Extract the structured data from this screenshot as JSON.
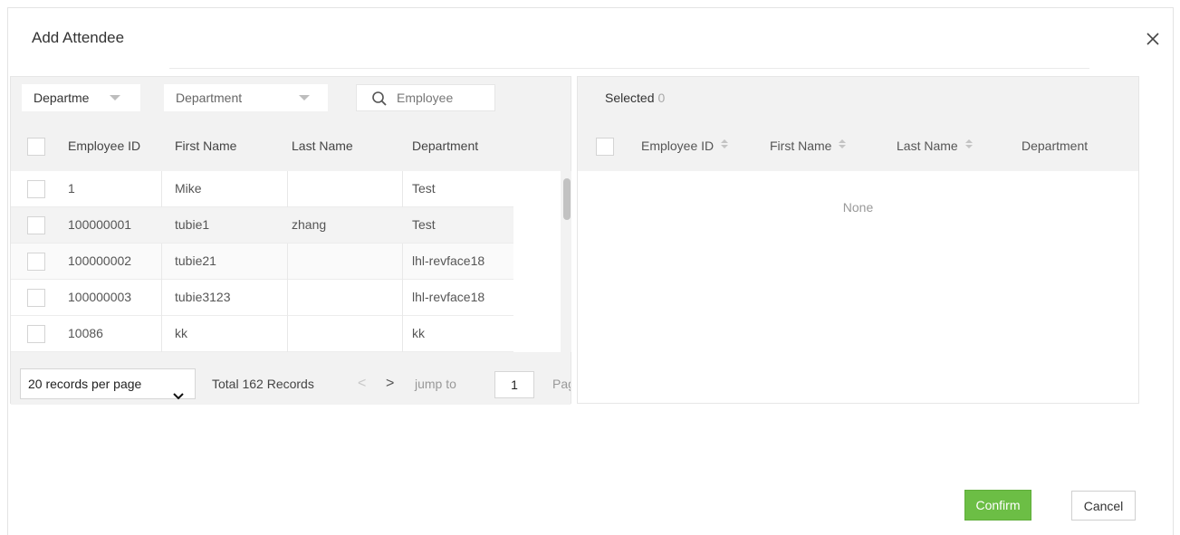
{
  "dialog": {
    "title": "Add Attendee"
  },
  "filters": {
    "field_select": "Departme",
    "department_select": "Department",
    "search_placeholder": "Employee"
  },
  "left_table": {
    "headers": {
      "employee_id": "Employee ID",
      "first_name": "First Name",
      "last_name": "Last Name",
      "department": "Department"
    },
    "rows": [
      {
        "employee_id": "1",
        "first_name": "Mike",
        "last_name": "",
        "department": "Test"
      },
      {
        "employee_id": "100000001",
        "first_name": "tubie1",
        "last_name": "zhang",
        "department": "Test"
      },
      {
        "employee_id": "100000002",
        "first_name": "tubie21",
        "last_name": "",
        "department": "lhl-revface18"
      },
      {
        "employee_id": "100000003",
        "first_name": "tubie3123",
        "last_name": "",
        "department": "lhl-revface18"
      },
      {
        "employee_id": "10086",
        "first_name": "kk",
        "last_name": "",
        "department": "kk"
      }
    ]
  },
  "pagination": {
    "per_page": "20 records per page",
    "total": "Total 162 Records",
    "prev": "<",
    "next": ">",
    "jump_label": "jump to",
    "jump_value": "1",
    "page_label": "Page"
  },
  "right_panel": {
    "selected_label": "Selected",
    "selected_count": "0",
    "headers": {
      "employee_id": "Employee ID",
      "first_name": "First Name",
      "last_name": "Last Name",
      "department": "Department"
    },
    "empty_text": "None"
  },
  "footer": {
    "confirm_label": "Confirm",
    "cancel_label": "Cancel"
  },
  "colors": {
    "confirm": "#6cbe45",
    "panel_bg": "#f2f2f2"
  },
  "icons": {
    "close": "close-icon",
    "search": "search-icon",
    "dropdown": "dropdown-arrow-icon",
    "sort": "sort-icon"
  }
}
